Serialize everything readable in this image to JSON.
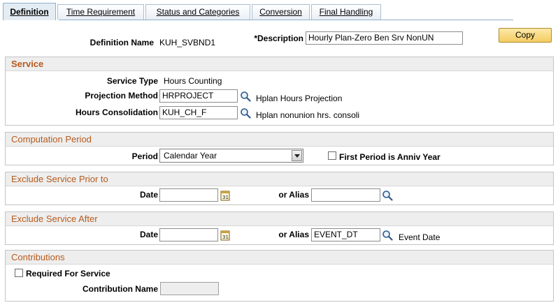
{
  "tabs": [
    {
      "label": "Definition",
      "active": true
    },
    {
      "label": "Time Requirement",
      "active": false
    },
    {
      "label": "Status and Categories",
      "active": false
    },
    {
      "label": "Conversion",
      "active": false
    },
    {
      "label": "Final Handling",
      "active": false
    }
  ],
  "header": {
    "definition_name_label": "Definition Name",
    "definition_name_value": "KUH_SVBND1",
    "description_label": "*Description",
    "description_value": "Hourly Plan-Zero Ben Srv NonUN",
    "copy_label": "Copy"
  },
  "service": {
    "title": "Service",
    "service_type_label": "Service Type",
    "service_type_value": "Hours Counting",
    "projection_method_label": "Projection Method",
    "projection_method_value": "HRPROJECT",
    "projection_method_desc": "Hplan Hours Projection",
    "hours_consolidation_label": "Hours Consolidation",
    "hours_consolidation_value": "KUH_CH_F",
    "hours_consolidation_desc": "Hplan nonunion hrs. consoli"
  },
  "computation_period": {
    "title": "Computation Period",
    "period_label": "Period",
    "period_value": "Calendar Year",
    "first_period_label": "First Period is Anniv Year",
    "first_period_checked": false
  },
  "exclude_prior": {
    "title": "Exclude Service Prior to",
    "date_label": "Date",
    "date_value": "",
    "alias_label": "or Alias",
    "alias_value": ""
  },
  "exclude_after": {
    "title": "Exclude Service After",
    "date_label": "Date",
    "date_value": "",
    "alias_label": "or Alias",
    "alias_value": "EVENT_DT",
    "alias_desc": "Event Date"
  },
  "contributions": {
    "title": "Contributions",
    "required_label": "Required For Service",
    "required_checked": false,
    "contribution_name_label": "Contribution Name",
    "contribution_name_value": ""
  },
  "icons": {
    "lookup": "magnifier-icon",
    "calendar": "calendar-icon",
    "dropdown": "chevron-down-icon"
  },
  "colors": {
    "section_title": "#b65a1c",
    "button": "#f4cc61",
    "tab_border": "#8fb0cc"
  }
}
